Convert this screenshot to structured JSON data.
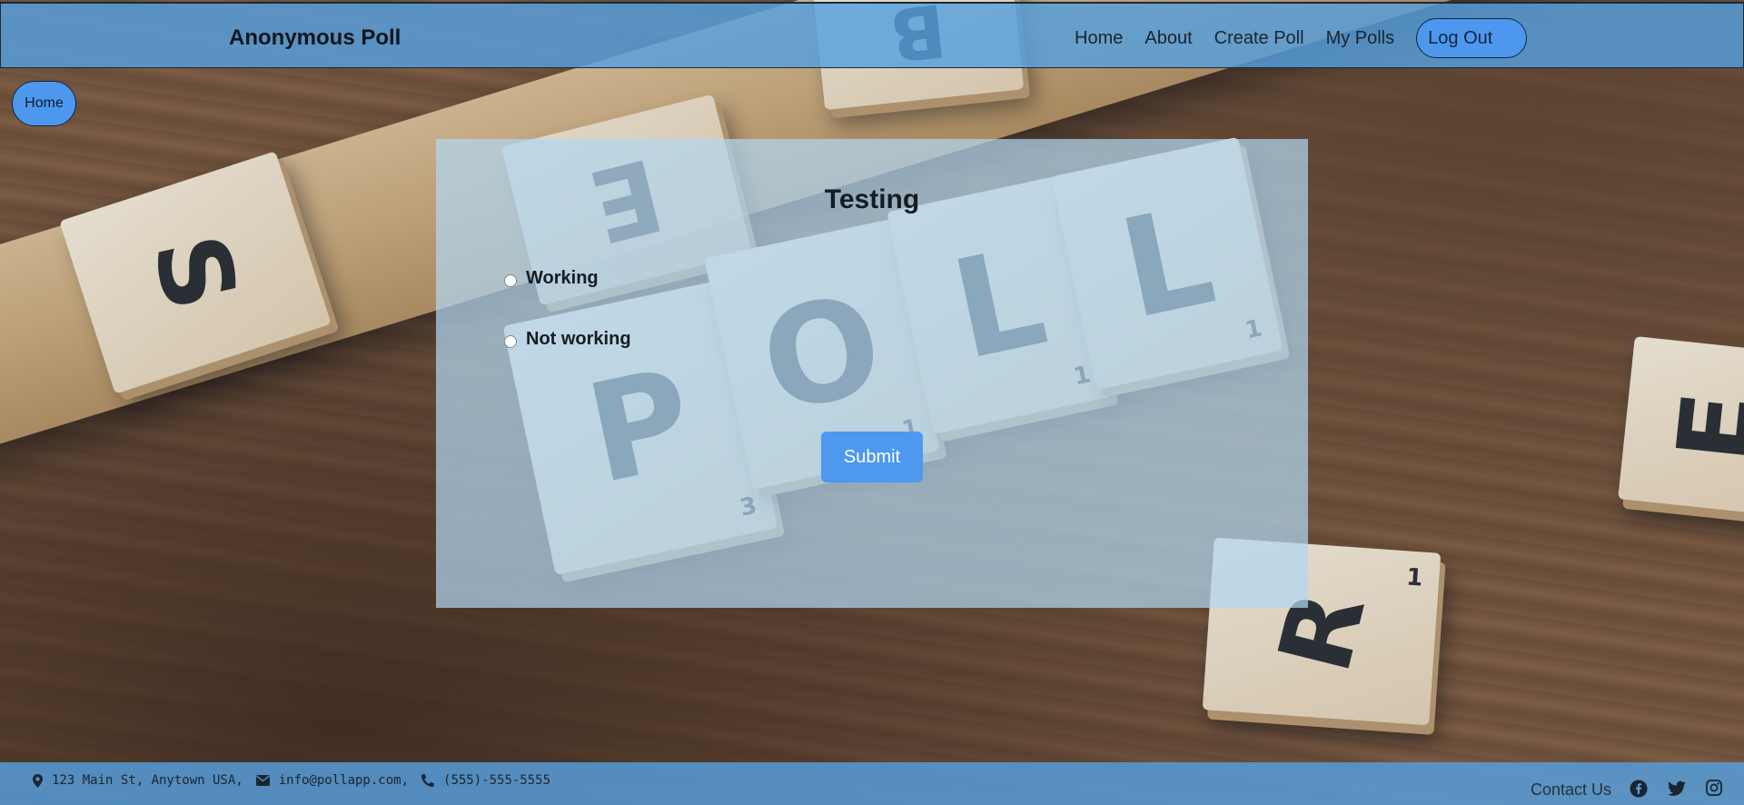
{
  "navbar": {
    "brand": "Anonymous Poll",
    "links": [
      "Home",
      "About",
      "Create Poll",
      "My Polls"
    ],
    "logout_label": "Log Out"
  },
  "home_button": "Home",
  "poll": {
    "title": "Testing",
    "options": [
      "Working",
      "Not working"
    ],
    "submit_label": "Submit"
  },
  "footer": {
    "address": "123 Main St, Anytown USA,",
    "email": "info@pollapp.com,",
    "phone": "(555)-555-5555",
    "contact_label": "Contact Us",
    "social_icons": [
      "facebook-icon",
      "twitter-icon",
      "instagram-icon"
    ]
  },
  "background": {
    "tiles": [
      {
        "letter": "P",
        "value": "3"
      },
      {
        "letter": "O",
        "value": "1"
      },
      {
        "letter": "L",
        "value": "1"
      },
      {
        "letter": "L",
        "value": "1"
      },
      {
        "letter": "S",
        "value": ""
      },
      {
        "letter": "E",
        "value": ""
      },
      {
        "letter": "B",
        "value": ""
      },
      {
        "letter": "R",
        "value": "1"
      },
      {
        "letter": "E",
        "value": ""
      }
    ]
  },
  "colors": {
    "accent": "#4d98ee",
    "bar": "#56a0de"
  }
}
